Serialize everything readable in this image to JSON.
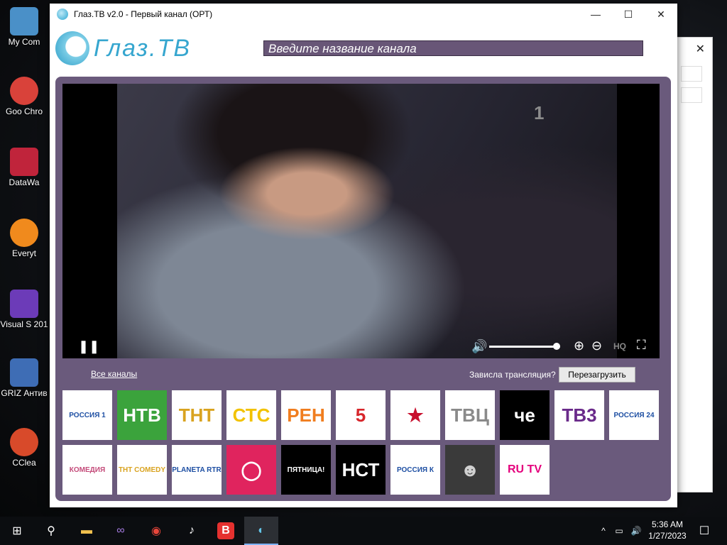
{
  "desktop": {
    "icons": [
      {
        "label": "My Com",
        "color": "#4a90c8"
      },
      {
        "label": "Goo Chro",
        "color": "#d9423a"
      },
      {
        "label": "DataWa",
        "color": "#c0243b"
      },
      {
        "label": "Everyt",
        "color": "#f08a1d"
      },
      {
        "label": "Visual S 201",
        "color": "#6c3bb8"
      },
      {
        "label": "GRIZ Антив",
        "color": "#3e6db5"
      },
      {
        "label": "CClea",
        "color": "#d84a2a"
      }
    ]
  },
  "window": {
    "title": "Глаз.ТВ v2.0 - Первый канал (ОРТ)",
    "minimize": "—",
    "maximize": "☐",
    "close": "✕"
  },
  "header": {
    "logo_text": "Глаз.ТВ",
    "search_placeholder": "Введите название канала"
  },
  "player": {
    "channel_logo": "1",
    "play_icon": "❚❚",
    "volume_icon": "🔊",
    "volume_level": 0.95,
    "zoom_in_icon": "⊕",
    "zoom_out_icon": "⊖",
    "hq_label": "HQ",
    "fullscreen_icon": "⛶"
  },
  "controls": {
    "all_channels": "Все каналы",
    "frozen_prompt": "Зависла трансляция?",
    "reload_label": "Перезагрузить"
  },
  "channels": [
    {
      "name": "РОССИЯ 1",
      "bg": "#ffffff",
      "fg": "#1e4fa3"
    },
    {
      "name": "НТВ",
      "bg": "#3ba33c",
      "fg": "#ffffff"
    },
    {
      "name": "ТНТ",
      "bg": "#ffffff",
      "fg": "#d9a320"
    },
    {
      "name": "СТС",
      "bg": "#ffffff",
      "fg": "#f2c200"
    },
    {
      "name": "РЕН",
      "bg": "#ffffff",
      "fg": "#f07d1f"
    },
    {
      "name": "5",
      "bg": "#ffffff",
      "fg": "#d7262b"
    },
    {
      "name": "★",
      "bg": "#ffffff",
      "fg": "#c8102e"
    },
    {
      "name": "ТВЦ",
      "bg": "#ffffff",
      "fg": "#8a8a8a"
    },
    {
      "name": "че",
      "bg": "#000000",
      "fg": "#ffffff"
    },
    {
      "name": "ТВ3",
      "bg": "#ffffff",
      "fg": "#6a2a8a"
    },
    {
      "name": "РОССИЯ 24",
      "bg": "#ffffff",
      "fg": "#1e4fa3"
    },
    {
      "name": "КОМЕДИЯ",
      "bg": "#ffffff",
      "fg": "#c44b7a"
    },
    {
      "name": "ТНТ COMEDY",
      "bg": "#ffffff",
      "fg": "#d9a320"
    },
    {
      "name": "PLANETA RTR",
      "bg": "#ffffff",
      "fg": "#1e4fa3"
    },
    {
      "name": "◯",
      "bg": "#e0245e",
      "fg": "#ffffff"
    },
    {
      "name": "ПЯТНИЦА!",
      "bg": "#000000",
      "fg": "#ffffff"
    },
    {
      "name": "НСТ",
      "bg": "#000000",
      "fg": "#ffffff"
    },
    {
      "name": "РОССИЯ К",
      "bg": "#ffffff",
      "fg": "#1e4fa3"
    },
    {
      "name": "☻",
      "bg": "#3a3a3a",
      "fg": "#d0d0d0"
    },
    {
      "name": "RU TV",
      "bg": "#ffffff",
      "fg": "#e4007c"
    }
  ],
  "taskbar": {
    "items": [
      {
        "name": "start",
        "glyph": "⊞"
      },
      {
        "name": "search",
        "glyph": "⚲"
      },
      {
        "name": "explorer",
        "glyph": "▬"
      },
      {
        "name": "visual-studio",
        "glyph": "∞"
      },
      {
        "name": "chrome",
        "glyph": "◉"
      },
      {
        "name": "tiktok",
        "glyph": "♪"
      },
      {
        "name": "b-app",
        "glyph": "B"
      },
      {
        "name": "glaz-tv",
        "glyph": "◐"
      }
    ],
    "time": "5:36 AM",
    "date": "1/27/2023",
    "tray_chevron": "^",
    "tray_network": "▭",
    "tray_volume": "🔊",
    "notifications": "☐"
  }
}
